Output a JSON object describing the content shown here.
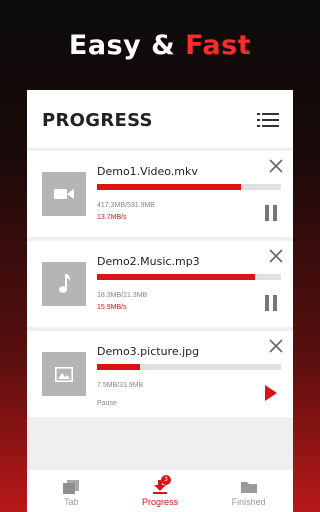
{
  "headline": {
    "word1": "Easy &",
    "word2": "Fast"
  },
  "panel": {
    "title": "PROGRESS"
  },
  "downloads": [
    {
      "name": "Demo1.Video.mkv",
      "size": "417.3MB/531.9MB",
      "speed": "13.7MB/s",
      "progress": 0.785,
      "type": "video",
      "state": "downloading"
    },
    {
      "name": "Demo2.Music.mp3",
      "size": "18.3MB/21.3MB",
      "speed": "15.9MB/s",
      "progress": 0.86,
      "type": "music",
      "state": "downloading"
    },
    {
      "name": "Demo3.picture.jpg",
      "size": "7.5MB/31.9MB",
      "status": "Pause",
      "progress": 0.235,
      "type": "picture",
      "state": "paused"
    }
  ],
  "nav": {
    "tab_label": "Tab",
    "progress_label": "Progress",
    "progress_badge": "3",
    "finished_label": "Finished"
  },
  "colors": {
    "accent": "#d81414",
    "thumb": "#b5b5b5"
  },
  "icons": [
    "list-icon",
    "video-icon",
    "music-icon",
    "picture-icon",
    "close-icon",
    "pause-icon",
    "play-icon",
    "tab-icon",
    "download-icon",
    "folder-icon"
  ]
}
